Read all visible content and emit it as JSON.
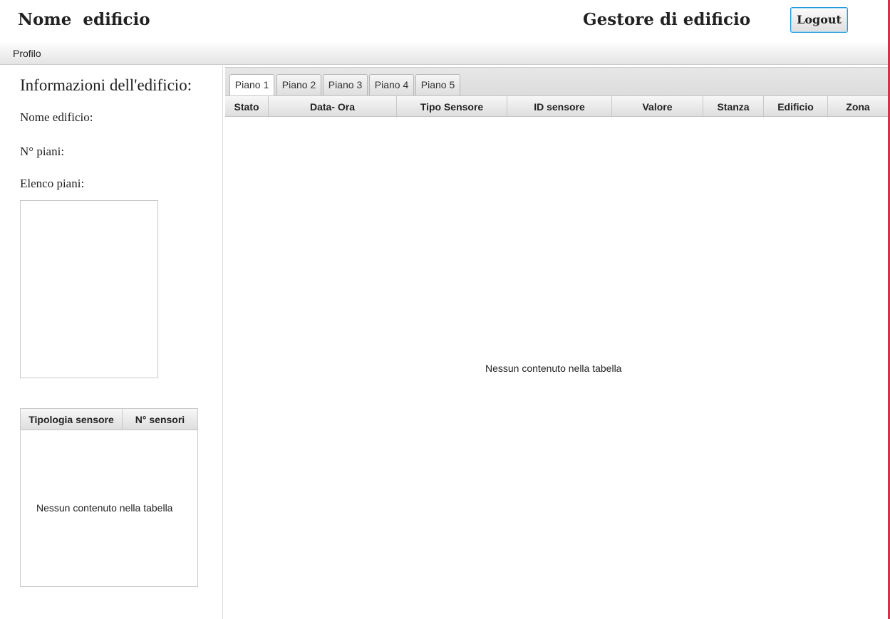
{
  "header": {
    "building_name": "Nome  edificio",
    "role_title": "Gestore di edificio",
    "logout_label": "Logout"
  },
  "menu": {
    "profile_label": "Profilo"
  },
  "sidebar": {
    "info_title": "Informazioni dell'edificio:",
    "building_name_label": "Nome edificio:",
    "floors_count_label": "N° piani:",
    "floors_list_label": "Elenco piani:",
    "sensor_table": {
      "columns": [
        "Tipologia sensore",
        "N° sensori"
      ],
      "empty_text": "Nessun contenuto nella tabella"
    }
  },
  "main": {
    "tabs": [
      {
        "label": "Piano 1",
        "selected": true
      },
      {
        "label": "Piano 2",
        "selected": false
      },
      {
        "label": "Piano 3",
        "selected": false
      },
      {
        "label": "Piano 4",
        "selected": false
      },
      {
        "label": "Piano 5",
        "selected": false
      }
    ],
    "table": {
      "columns": [
        "Stato",
        "Data- Ora",
        "Tipo Sensore",
        "ID sensore",
        "Valore",
        "Stanza",
        "Edificio",
        "Zona"
      ],
      "empty_text": "Nessun contenuto nella tabella"
    }
  }
}
